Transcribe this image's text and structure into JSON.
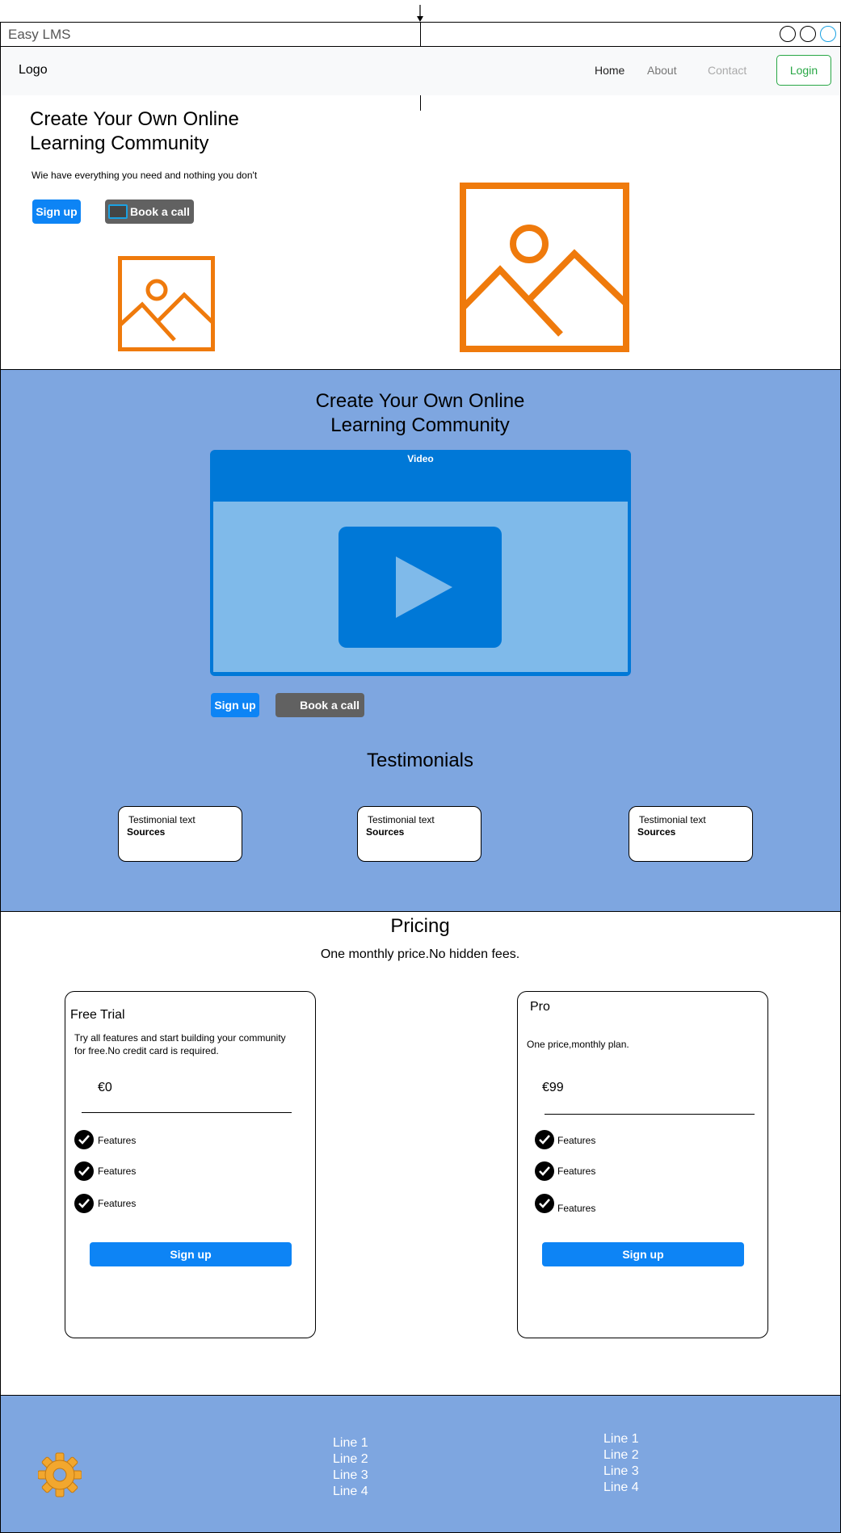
{
  "window": {
    "title": "Easy LMS"
  },
  "navbar": {
    "logo": "Logo",
    "links": [
      {
        "label": "Home",
        "color": "#222222"
      },
      {
        "label": "About",
        "color": "#777777"
      },
      {
        "label": "Contact",
        "color": "#aaaaaa"
      }
    ],
    "login_label": "Login"
  },
  "hero": {
    "title_line1": "Create Your Own Online",
    "title_line2": "Learning Community",
    "subtitle": "Wie have everything you need and nothing you don't",
    "signup_label": "Sign up",
    "book_label": "Book a call",
    "image_icon": "image-placeholder-icon"
  },
  "video_section": {
    "title_line1": "Create Your Own Online",
    "title_line2": "Learning Community",
    "video_label": "Video",
    "signup_label": "Sign up",
    "book_label": "Book a call",
    "testimonials_title": "Testimonials",
    "testimonials": [
      {
        "text": "Testimonial text",
        "source": "Sources"
      },
      {
        "text": "Testimonial text",
        "source": "Sources"
      },
      {
        "text": "Testimonial text",
        "source": "Sources"
      }
    ]
  },
  "pricing": {
    "title": "Pricing",
    "subtitle": "One monthly price.No hidden fees.",
    "plans": [
      {
        "name": "Free Trial",
        "description_line1": "Try all features and start building your community",
        "description_line2": "for free.No credit card is required.",
        "price": "€0",
        "features": [
          "Features",
          "Features",
          "Features"
        ],
        "cta": "Sign up"
      },
      {
        "name": "Pro",
        "description_line1": "One price,monthly plan.",
        "description_line2": "",
        "price": "€99",
        "features": [
          "Features",
          "Features",
          "Features"
        ],
        "cta": "Sign up"
      }
    ]
  },
  "footer": {
    "icon": "gear-icon",
    "column1": [
      "Line 1",
      "Line 2",
      "Line 3",
      "Line 4"
    ],
    "column2": [
      "Line 1",
      "Line 2",
      "Line 3",
      "Line 4"
    ]
  },
  "colors": {
    "accent_blue": "#0d84f5",
    "section_blue": "#7ea6e0",
    "image_orange": "#ef7a0c",
    "login_green": "#28a745"
  }
}
